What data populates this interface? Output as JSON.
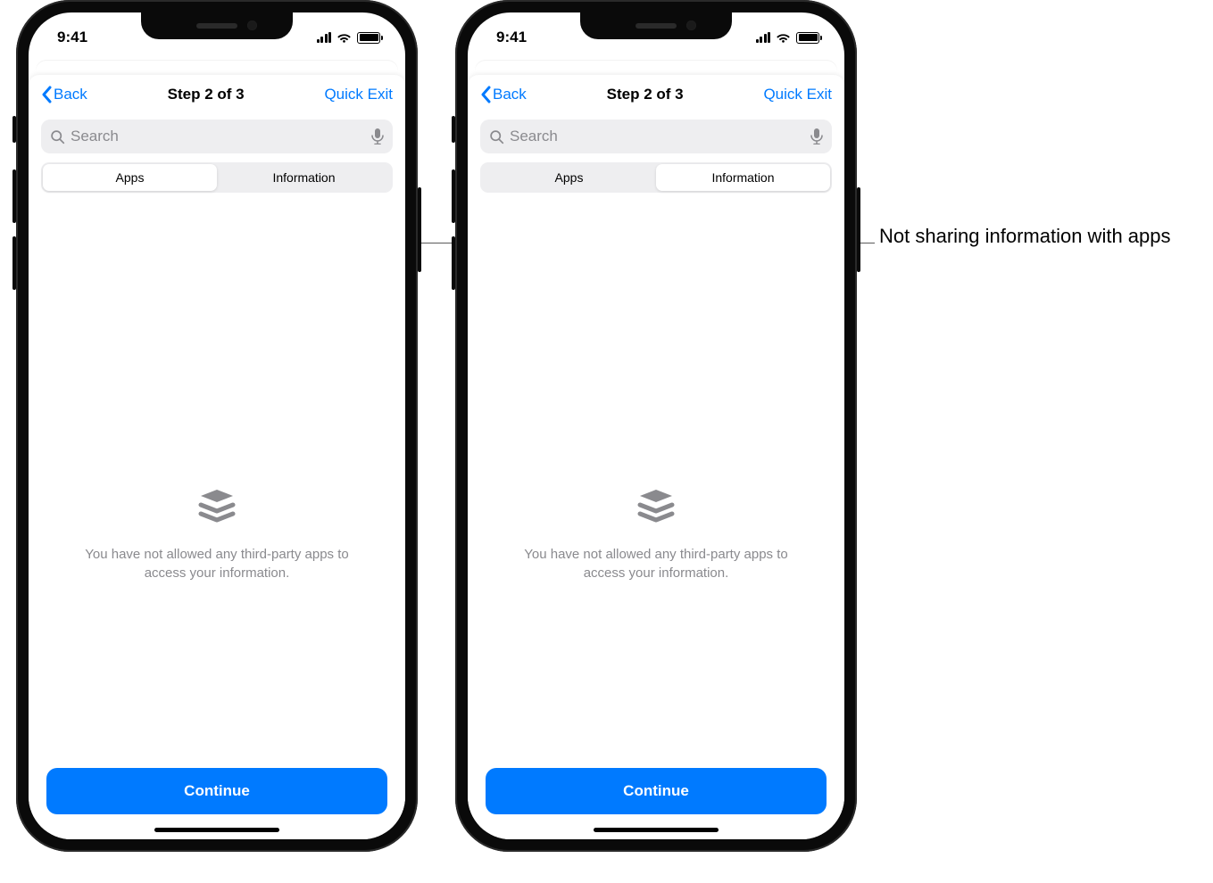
{
  "status": {
    "time": "9:41"
  },
  "nav": {
    "back_label": "Back",
    "title": "Step 2 of 3",
    "quick_exit": "Quick Exit"
  },
  "search": {
    "placeholder": "Search"
  },
  "segmented": {
    "apps_label": "Apps",
    "info_label": "Information"
  },
  "empty_state": {
    "text": "You have not allowed any third-party apps to access your information."
  },
  "cta": {
    "continue_label": "Continue"
  },
  "phones": {
    "left": {
      "active_segment_index": 0
    },
    "right": {
      "active_segment_index": 1
    }
  },
  "annotation": {
    "text": "Not sharing information with apps"
  }
}
